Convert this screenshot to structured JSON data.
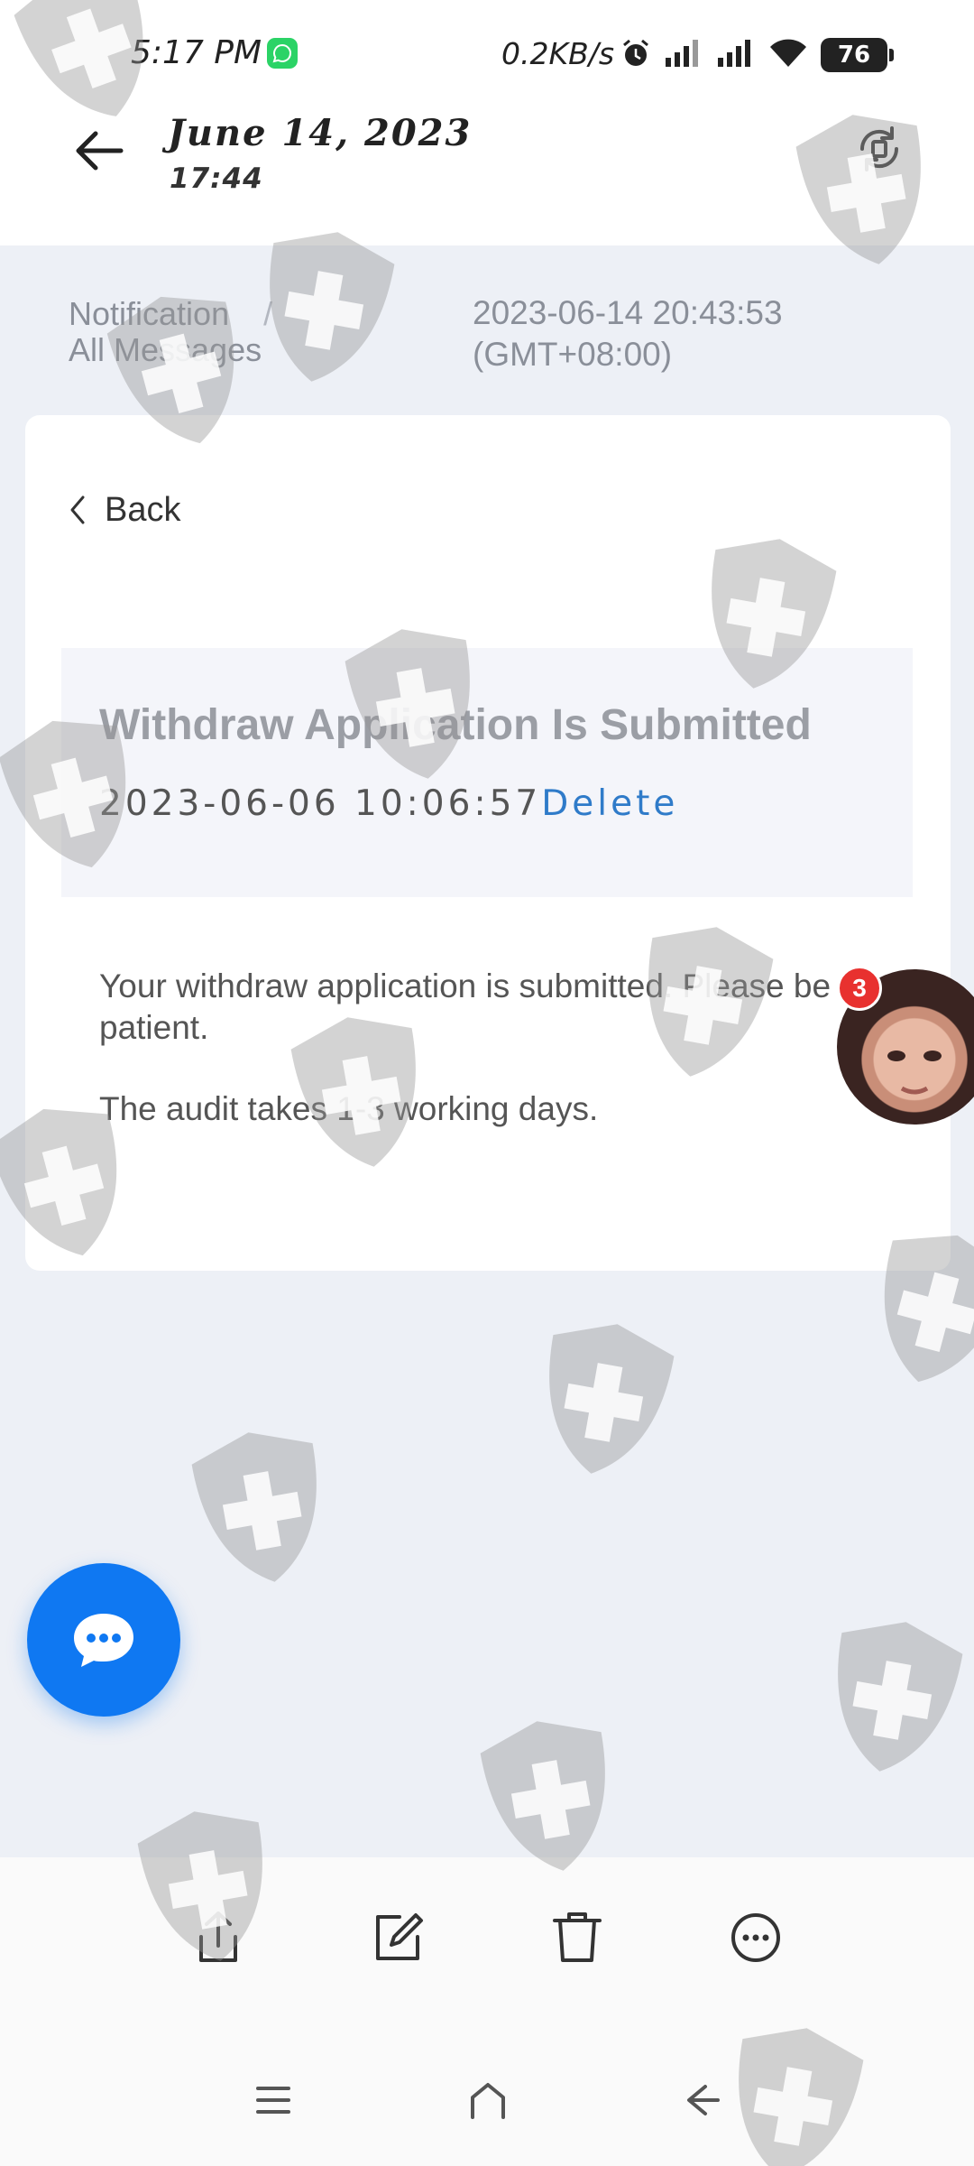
{
  "status_bar": {
    "time": "5:17 PM",
    "net_speed": "0.2KB/s",
    "battery": "76"
  },
  "app_bar": {
    "date": "June 14, 2023",
    "time": "17:44"
  },
  "breadcrumb": {
    "section": "Notification",
    "separator": "/",
    "page": "All Messages"
  },
  "timestamp": {
    "line1": "2023-06-14 20:43:53",
    "line2": "(GMT+08:00)"
  },
  "card": {
    "back_label": "Back",
    "title": "Withdraw Application Is Submitted",
    "date": "2023-06-06 10:06:57",
    "delete_label": "Delete",
    "body_1": "Your withdraw application is submitted. Please be patient.",
    "body_2": "The audit takes 1-3 working days."
  },
  "floating_avatar": {
    "badge_count": "3"
  },
  "colors": {
    "accent": "#0f78f2",
    "link": "#2f7bc9",
    "badge": "#e8312f",
    "page_bg": "#edf0f6"
  },
  "icons": {
    "toolbar": [
      "share-icon",
      "edit-icon",
      "delete-icon",
      "more-icon"
    ],
    "nav": [
      "menu-icon",
      "home-icon",
      "back-icon"
    ]
  }
}
